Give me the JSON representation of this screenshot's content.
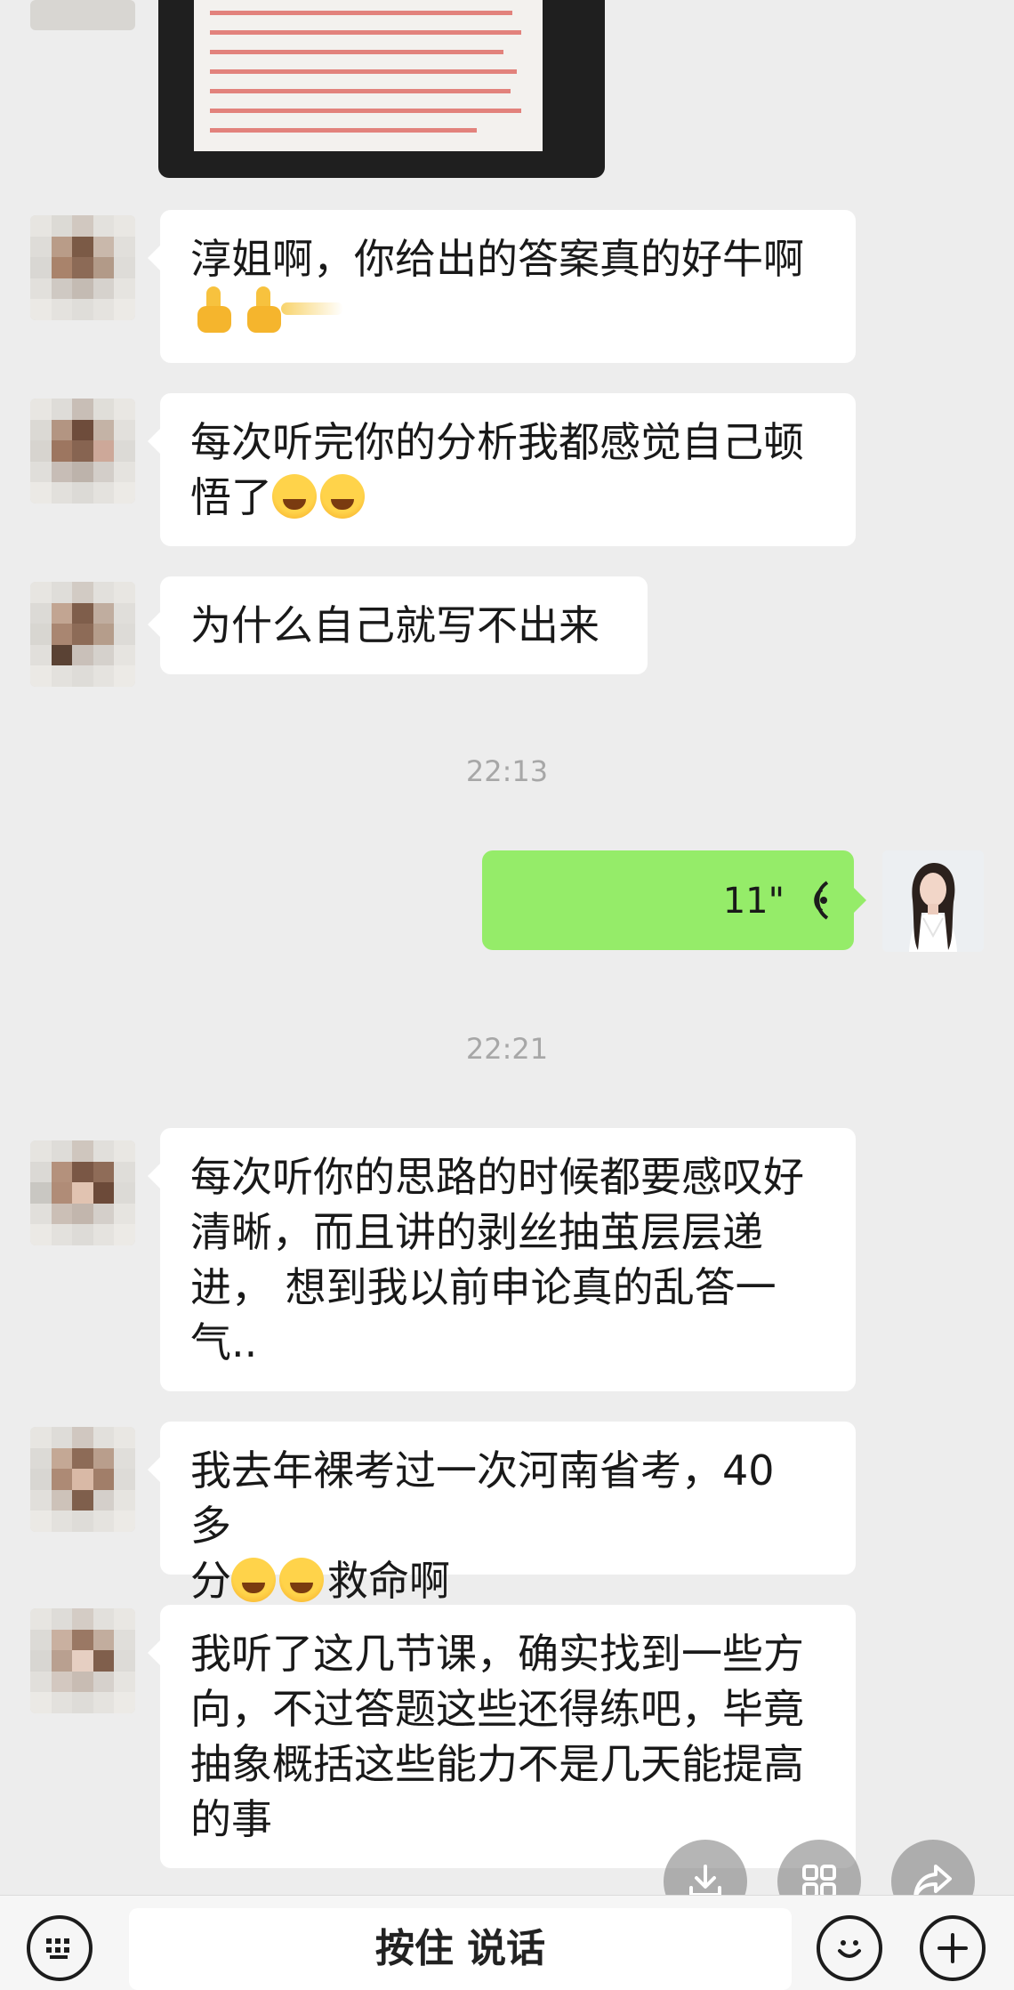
{
  "messages": [
    {
      "type": "text",
      "text": "淳姐啊，你给出的答案真的好牛啊"
    },
    {
      "type": "text",
      "text": "每次听完你的分析我都感觉自己顿\n悟了"
    },
    {
      "type": "text",
      "text": "为什么自己就写不出来"
    },
    {
      "type": "text",
      "text": "每次听你的思路的时候都要感叹好\n清晰，而且讲的剥丝抽茧层层递\n进， 想到我以前申论真的乱答一\n气.."
    },
    {
      "type": "text",
      "text": "我去年裸考过一次河南省考，40 多\n分"
    },
    {
      "type": "text",
      "text": "救命啊"
    },
    {
      "type": "text",
      "text": "我听了这几节课，确实找到一些方\n向，不过答题这些还得练吧，毕竟\n抽象概括这些能力不是几天能提高\n的事"
    }
  ],
  "timestamps": [
    "22:13",
    "22:21"
  ],
  "voice": {
    "duration": "11\""
  },
  "bottom_bar": {
    "hold_to_talk": "按住 说话"
  },
  "icons": {
    "keyboard": "keyboard-icon",
    "emoji": "emoji-icon",
    "plus": "plus-icon",
    "download": "download-icon",
    "grid": "grid-icon",
    "share": "share-icon",
    "voice_wave": "voice-wave-icon"
  },
  "colors": {
    "background": "#ededed",
    "bubble_self": "#95ec69",
    "bubble_other": "#ffffff",
    "timestamp": "#a7a7a7"
  }
}
